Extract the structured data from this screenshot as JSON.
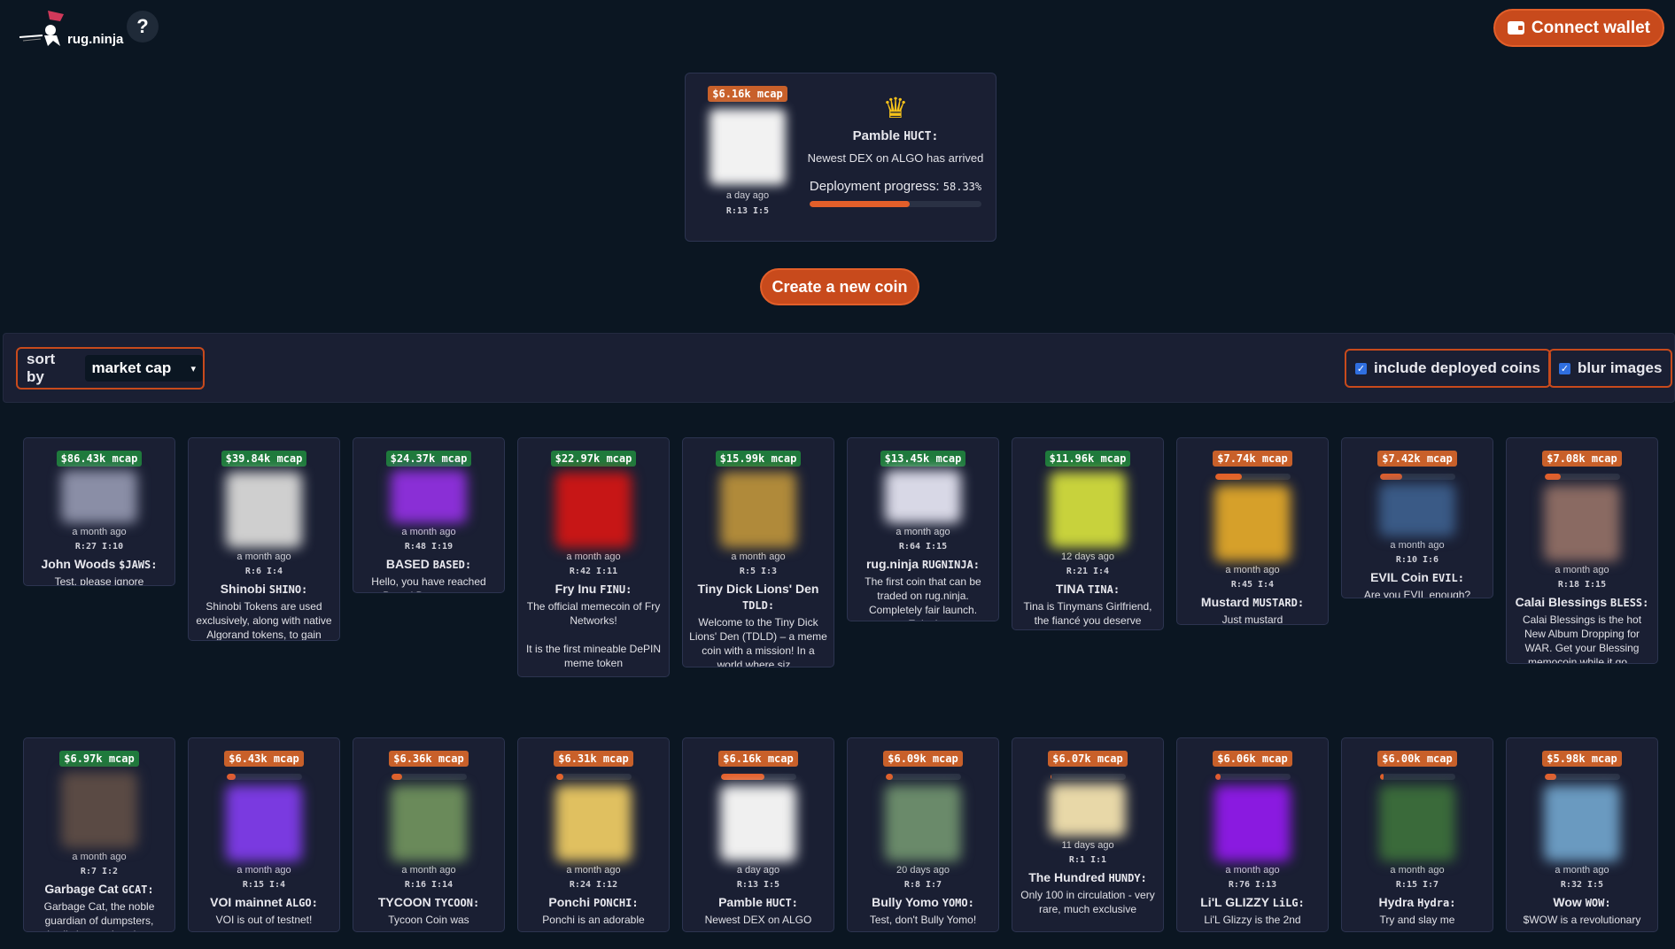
{
  "header": {
    "logo_text": "rug.ninja",
    "help_label": "?",
    "connect_label": "Connect wallet"
  },
  "featured": {
    "mcap": "$6.16k mcap",
    "time": "a day ago",
    "ri": "R:13 I:5",
    "name": "Pamble",
    "ticker": "HUCT:",
    "desc": "Newest DEX on ALGO has arrived",
    "progress_label": "Deployment progress:",
    "progress_value": "58.33%",
    "progress": 0.5833
  },
  "create_label": "Create a new coin",
  "toolbar": {
    "sort_label": "sort by",
    "sort_value": "market cap",
    "include_label": "include deployed coins",
    "blur_label": "blur images"
  },
  "cards": [
    {
      "mcap": "$86.43k mcap",
      "deployed": true,
      "time": "a month ago",
      "ri": "R:27 I:10",
      "name": "John Woods",
      "ticker": "$JAWS:",
      "desc": "Test, please ignore",
      "color": "#8a8ea6",
      "img": "short"
    },
    {
      "mcap": "$39.84k mcap",
      "deployed": true,
      "time": "a month ago",
      "ri": "R:6 I:4",
      "name": "Shinobi",
      "ticker": "SHINO:",
      "desc": "Shinobi Tokens are used exclusively, along with native Algorand tokens, to gain access to the...",
      "color": "#cfcfcf",
      "img": "full"
    },
    {
      "mcap": "$24.37k mcap",
      "deployed": true,
      "time": "a month ago",
      "ri": "R:48 I:19",
      "name": "BASED",
      "ticker": "BASED:",
      "desc": "Hello, you have reached Based Department.",
      "color": "#8a2fd6",
      "img": "short"
    },
    {
      "mcap": "$22.97k mcap",
      "deployed": true,
      "time": "a month ago",
      "ri": "R:42 I:11",
      "name": "Fry Inu",
      "ticker": "FINU:",
      "desc": "The official memecoin of Fry Networks!\n\nIt is the first mineable DePIN meme token\n\nJoin us on...",
      "color": "#c71616",
      "img": "full"
    },
    {
      "mcap": "$15.99k mcap",
      "deployed": true,
      "time": "a month ago",
      "ri": "R:5 I:3",
      "name": "Tiny Dick Lions' Den",
      "ticker": "TDLD:",
      "desc": "Welcome to the Tiny Dick Lions' Den (TDLD) – a meme coin with a mission! In a world where siz...",
      "color": "#b08a3a",
      "img": "full"
    },
    {
      "mcap": "$13.45k mcap",
      "deployed": true,
      "time": "a month ago",
      "ri": "R:64 I:15",
      "name": "rug.ninja",
      "ticker": "RUGNINJA:",
      "desc": "The first coin that can be traded on rug.ninja. Completely fair launch. Enjoy!",
      "color": "#d8d8e6",
      "img": "short"
    },
    {
      "mcap": "$11.96k mcap",
      "deployed": true,
      "time": "12 days ago",
      "ri": "R:21 I:4",
      "name": "TINA",
      "ticker": "TINA:",
      "desc": "Tina is Tinymans Girlfriend, the fiancé you deserve",
      "color": "#c8d23c",
      "img": "full"
    },
    {
      "mcap": "$7.74k mcap",
      "deployed": false,
      "progress": 0.36,
      "time": "a month ago",
      "ri": "R:45 I:4",
      "name": "Mustard",
      "ticker": "MUSTARD:",
      "desc": "Just mustard",
      "color": "#d6a02a",
      "img": "full"
    },
    {
      "mcap": "$7.42k mcap",
      "deployed": false,
      "progress": 0.3,
      "time": "a month ago",
      "ri": "R:10 I:6",
      "name": "EVIL Coin",
      "ticker": "EVIL:",
      "desc": "Are you EVIL enough?",
      "color": "#3a5a86",
      "img": "short"
    },
    {
      "mcap": "$7.08k mcap",
      "deployed": false,
      "progress": 0.22,
      "time": "a month ago",
      "ri": "R:18 I:15",
      "name": "Calai Blessings",
      "ticker": "BLESS:",
      "desc": "Calai Blessings is the hot New Album Dropping for WAR. Get your Blessing memocoin while it go...",
      "color": "#8a6a62",
      "img": "full"
    },
    {
      "mcap": "$6.97k mcap",
      "deployed": true,
      "time": "a month ago",
      "ri": "R:7 I:2",
      "name": "Garbage Cat",
      "ticker": "GCAT:",
      "desc": "Garbage Cat, the noble guardian of dumpsters, dwells in a realm where",
      "color": "#5a4a44",
      "img": "full"
    },
    {
      "mcap": "$6.43k mcap",
      "deployed": false,
      "progress": 0.12,
      "time": "a month ago",
      "ri": "R:15 I:4",
      "name": "VOI mainnet",
      "ticker": "ALGO:",
      "desc": "VOI is out of testnet!",
      "color": "#7a3ae0",
      "img": "full"
    },
    {
      "mcap": "$6.36k mcap",
      "deployed": false,
      "progress": 0.15,
      "time": "a month ago",
      "ri": "R:16 I:14",
      "name": "TYCOON",
      "ticker": "TYCOON:",
      "desc": "Tycoon Coin was",
      "color": "#6a8a5a",
      "img": "full"
    },
    {
      "mcap": "$6.31k mcap",
      "deployed": false,
      "progress": 0.1,
      "time": "a month ago",
      "ri": "R:24 I:12",
      "name": "Ponchi",
      "ticker": "PONCHI:",
      "desc": "Ponchi is an adorable",
      "color": "#e0c060",
      "img": "full"
    },
    {
      "mcap": "$6.16k mcap",
      "deployed": false,
      "progress": 0.58,
      "time": "a day ago",
      "ri": "R:13 I:5",
      "name": "Pamble",
      "ticker": "HUCT:",
      "desc": "Newest DEX on ALGO",
      "color": "#f0f0f0",
      "img": "full"
    },
    {
      "mcap": "$6.09k mcap",
      "deployed": false,
      "progress": 0.1,
      "time": "20 days ago",
      "ri": "R:8 I:7",
      "name": "Bully Yomo",
      "ticker": "YOMO:",
      "desc": "Test, don't Bully Yomo!",
      "color": "#6a8a6a",
      "img": "full"
    },
    {
      "mcap": "$6.07k mcap",
      "deployed": false,
      "progress": 0.02,
      "time": "11 days ago",
      "ri": "R:1 I:1",
      "name": "The Hundred",
      "ticker": "HUNDY:",
      "desc": "Only 100 in circulation - very rare, much exclusive",
      "color": "#e8d8a8",
      "img": "short"
    },
    {
      "mcap": "$6.06k mcap",
      "deployed": false,
      "progress": 0.08,
      "time": "a month ago",
      "ri": "R:76 I:13",
      "name": "Li'L GLIZZY",
      "ticker": "LiLG:",
      "desc": "Li'L Glizzy is the 2nd",
      "color": "#8a1ae0",
      "img": "full"
    },
    {
      "mcap": "$6.00k mcap",
      "deployed": false,
      "progress": 0.05,
      "time": "a month ago",
      "ri": "R:15 I:7",
      "name": "Hydra",
      "ticker": "Hydra:",
      "desc": "Try and slay me",
      "color": "#3a6a3a",
      "img": "full"
    },
    {
      "mcap": "$5.98k mcap",
      "deployed": false,
      "progress": 0.16,
      "time": "a month ago",
      "ri": "R:32 I:5",
      "name": "Wow",
      "ticker": "WOW:",
      "desc": "$WOW is a revolutionary",
      "color": "#6a9ac0",
      "img": "full"
    }
  ]
}
